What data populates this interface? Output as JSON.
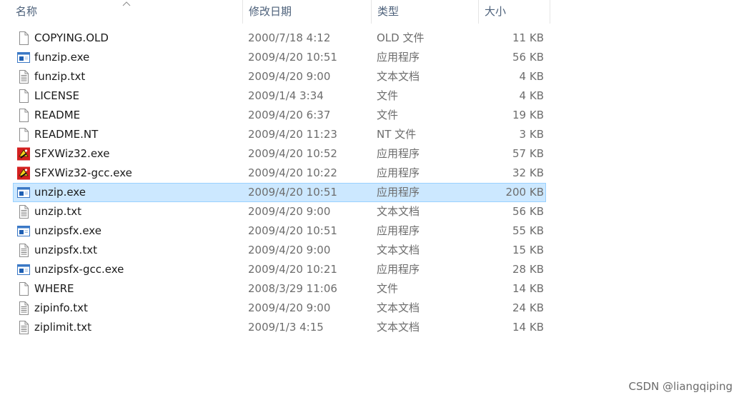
{
  "columns": {
    "name": "名称",
    "date": "修改日期",
    "type": "类型",
    "size": "大小"
  },
  "files": [
    {
      "name": "COPYING.OLD",
      "date": "2000/7/18 4:12",
      "type": "OLD 文件",
      "size": "11 KB",
      "icon": "blank-file-icon"
    },
    {
      "name": "funzip.exe",
      "date": "2009/4/20 10:51",
      "type": "应用程序",
      "size": "56 KB",
      "icon": "app-window-icon"
    },
    {
      "name": "funzip.txt",
      "date": "2009/4/20 9:00",
      "type": "文本文档",
      "size": "4 KB",
      "icon": "text-file-icon"
    },
    {
      "name": "LICENSE",
      "date": "2009/1/4 3:34",
      "type": "文件",
      "size": "4 KB",
      "icon": "blank-file-icon"
    },
    {
      "name": "README",
      "date": "2009/4/20 6:37",
      "type": "文件",
      "size": "19 KB",
      "icon": "blank-file-icon"
    },
    {
      "name": "README.NT",
      "date": "2009/4/20 11:23",
      "type": "NT 文件",
      "size": "3 KB",
      "icon": "blank-file-icon"
    },
    {
      "name": "SFXWiz32.exe",
      "date": "2009/4/20 10:52",
      "type": "应用程序",
      "size": "57 KB",
      "icon": "sfx-wizard-icon"
    },
    {
      "name": "SFXWiz32-gcc.exe",
      "date": "2009/4/20 10:22",
      "type": "应用程序",
      "size": "32 KB",
      "icon": "sfx-wizard-icon"
    },
    {
      "name": "unzip.exe",
      "date": "2009/4/20 10:51",
      "type": "应用程序",
      "size": "200 KB",
      "icon": "app-window-icon"
    },
    {
      "name": "unzip.txt",
      "date": "2009/4/20 9:00",
      "type": "文本文档",
      "size": "56 KB",
      "icon": "text-file-icon"
    },
    {
      "name": "unzipsfx.exe",
      "date": "2009/4/20 10:51",
      "type": "应用程序",
      "size": "55 KB",
      "icon": "app-window-icon"
    },
    {
      "name": "unzipsfx.txt",
      "date": "2009/4/20 9:00",
      "type": "文本文档",
      "size": "15 KB",
      "icon": "text-file-icon"
    },
    {
      "name": "unzipsfx-gcc.exe",
      "date": "2009/4/20 10:21",
      "type": "应用程序",
      "size": "28 KB",
      "icon": "app-window-icon"
    },
    {
      "name": "WHERE",
      "date": "2008/3/29 11:06",
      "type": "文件",
      "size": "14 KB",
      "icon": "blank-file-icon"
    },
    {
      "name": "zipinfo.txt",
      "date": "2009/4/20 9:00",
      "type": "文本文档",
      "size": "24 KB",
      "icon": "text-file-icon"
    },
    {
      "name": "ziplimit.txt",
      "date": "2009/1/3 4:15",
      "type": "文本文档",
      "size": "14 KB",
      "icon": "text-file-icon"
    }
  ],
  "selected_file": "unzip.exe",
  "watermark": "CSDN @liangqiping",
  "colors": {
    "selection_bg": "#cce8ff",
    "selection_border": "#99d1ff",
    "header_text": "#4c607a"
  }
}
